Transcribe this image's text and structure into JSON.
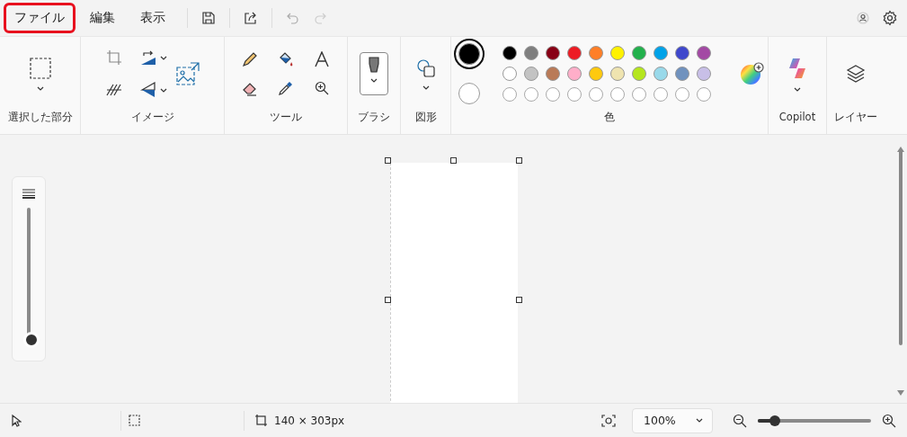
{
  "menu": [
    {
      "label": "ファイル",
      "highlighted": true
    },
    {
      "label": "編集",
      "highlighted": false
    },
    {
      "label": "表示",
      "highlighted": false
    }
  ],
  "ribbon": {
    "groups": [
      {
        "kind": "selection",
        "label": "選択した部分"
      },
      {
        "kind": "image",
        "label": "イメージ"
      },
      {
        "kind": "tools",
        "label": "ツール"
      },
      {
        "kind": "brush",
        "label": "ブラシ"
      },
      {
        "kind": "shapes",
        "label": "図形"
      },
      {
        "kind": "colors",
        "label": "色"
      },
      {
        "kind": "copilot",
        "label": "Copilot"
      },
      {
        "kind": "layers",
        "label": "レイヤー"
      }
    ],
    "current_colors": [
      {
        "color": "#000000",
        "selected": true
      },
      {
        "color": "#ffffff",
        "selected": false
      }
    ],
    "palette": [
      {
        "color": "#000000"
      },
      {
        "color": "#7f7f7f"
      },
      {
        "color": "#880015"
      },
      {
        "color": "#ed1c24"
      },
      {
        "color": "#ff7f27"
      },
      {
        "color": "#fff200"
      },
      {
        "color": "#22b14c"
      },
      {
        "color": "#00a2e8"
      },
      {
        "color": "#3f48cc"
      },
      {
        "color": "#a349a4"
      },
      {
        "color": "#ffffff"
      },
      {
        "color": "#c3c3c3"
      },
      {
        "color": "#b97a57"
      },
      {
        "color": "#ffaec9"
      },
      {
        "color": "#ffc90e"
      },
      {
        "color": "#efe4b0"
      },
      {
        "color": "#b5e61d"
      },
      {
        "color": "#99d9ea"
      },
      {
        "color": "#7092be"
      },
      {
        "color": "#c8bfe7"
      }
    ]
  },
  "brush_size": {
    "level": 0.0
  },
  "status_bar": {
    "canvas_size": "140 × 303px",
    "zoom": "100%",
    "zoom_slider": {
      "level": 0.15
    }
  }
}
